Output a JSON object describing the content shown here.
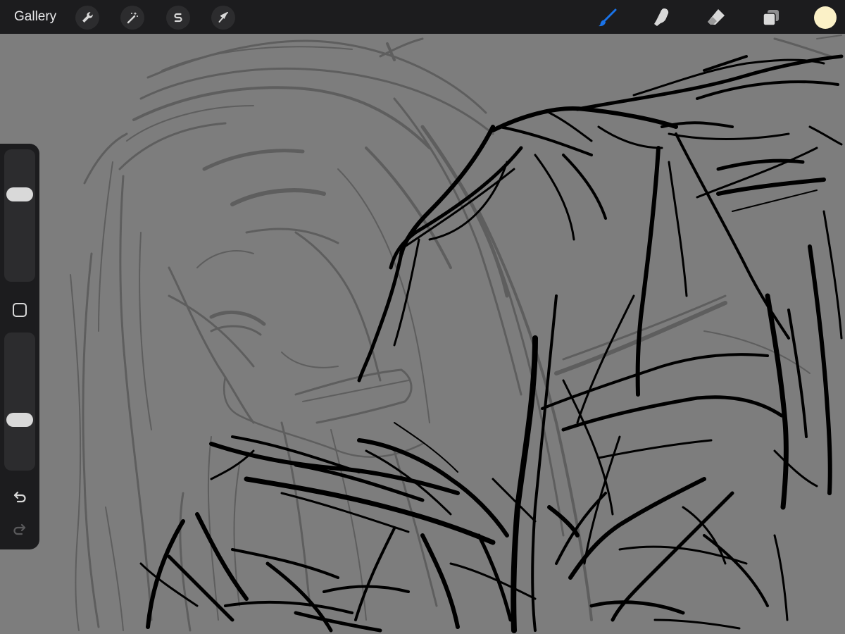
{
  "topbar": {
    "gallery_label": "Gallery",
    "left_tools": [
      {
        "name": "actions",
        "icon": "wrench-icon"
      },
      {
        "name": "adjustments",
        "icon": "magic-wand-icon"
      },
      {
        "name": "selection",
        "icon": "s-selection-icon"
      },
      {
        "name": "transform",
        "icon": "arrow-cursor-icon"
      }
    ],
    "right_tools": [
      {
        "name": "brush",
        "icon": "brush-icon",
        "active": true
      },
      {
        "name": "smudge",
        "icon": "smudge-finger-icon",
        "active": false
      },
      {
        "name": "eraser",
        "icon": "eraser-icon",
        "active": false
      },
      {
        "name": "layers",
        "icon": "layers-icon",
        "active": false
      }
    ],
    "current_color": "#fbf1c7"
  },
  "sidebar": {
    "brush_size_level": 0.31,
    "opacity_level": 0.66,
    "modify_icon": "square-outline-icon",
    "undo_icon": "undo-arrow-icon",
    "redo_icon": "redo-arrow-icon"
  },
  "colors": {
    "bar_bg": "#1c1c1e",
    "button_bg": "#2c2c2e",
    "icon": "#d8d8d8",
    "active_tool": "#1a73e8",
    "canvas_bg": "#7d7d7d",
    "sketch_light": "#5e5e5e",
    "sketch_dark": "#000000"
  }
}
